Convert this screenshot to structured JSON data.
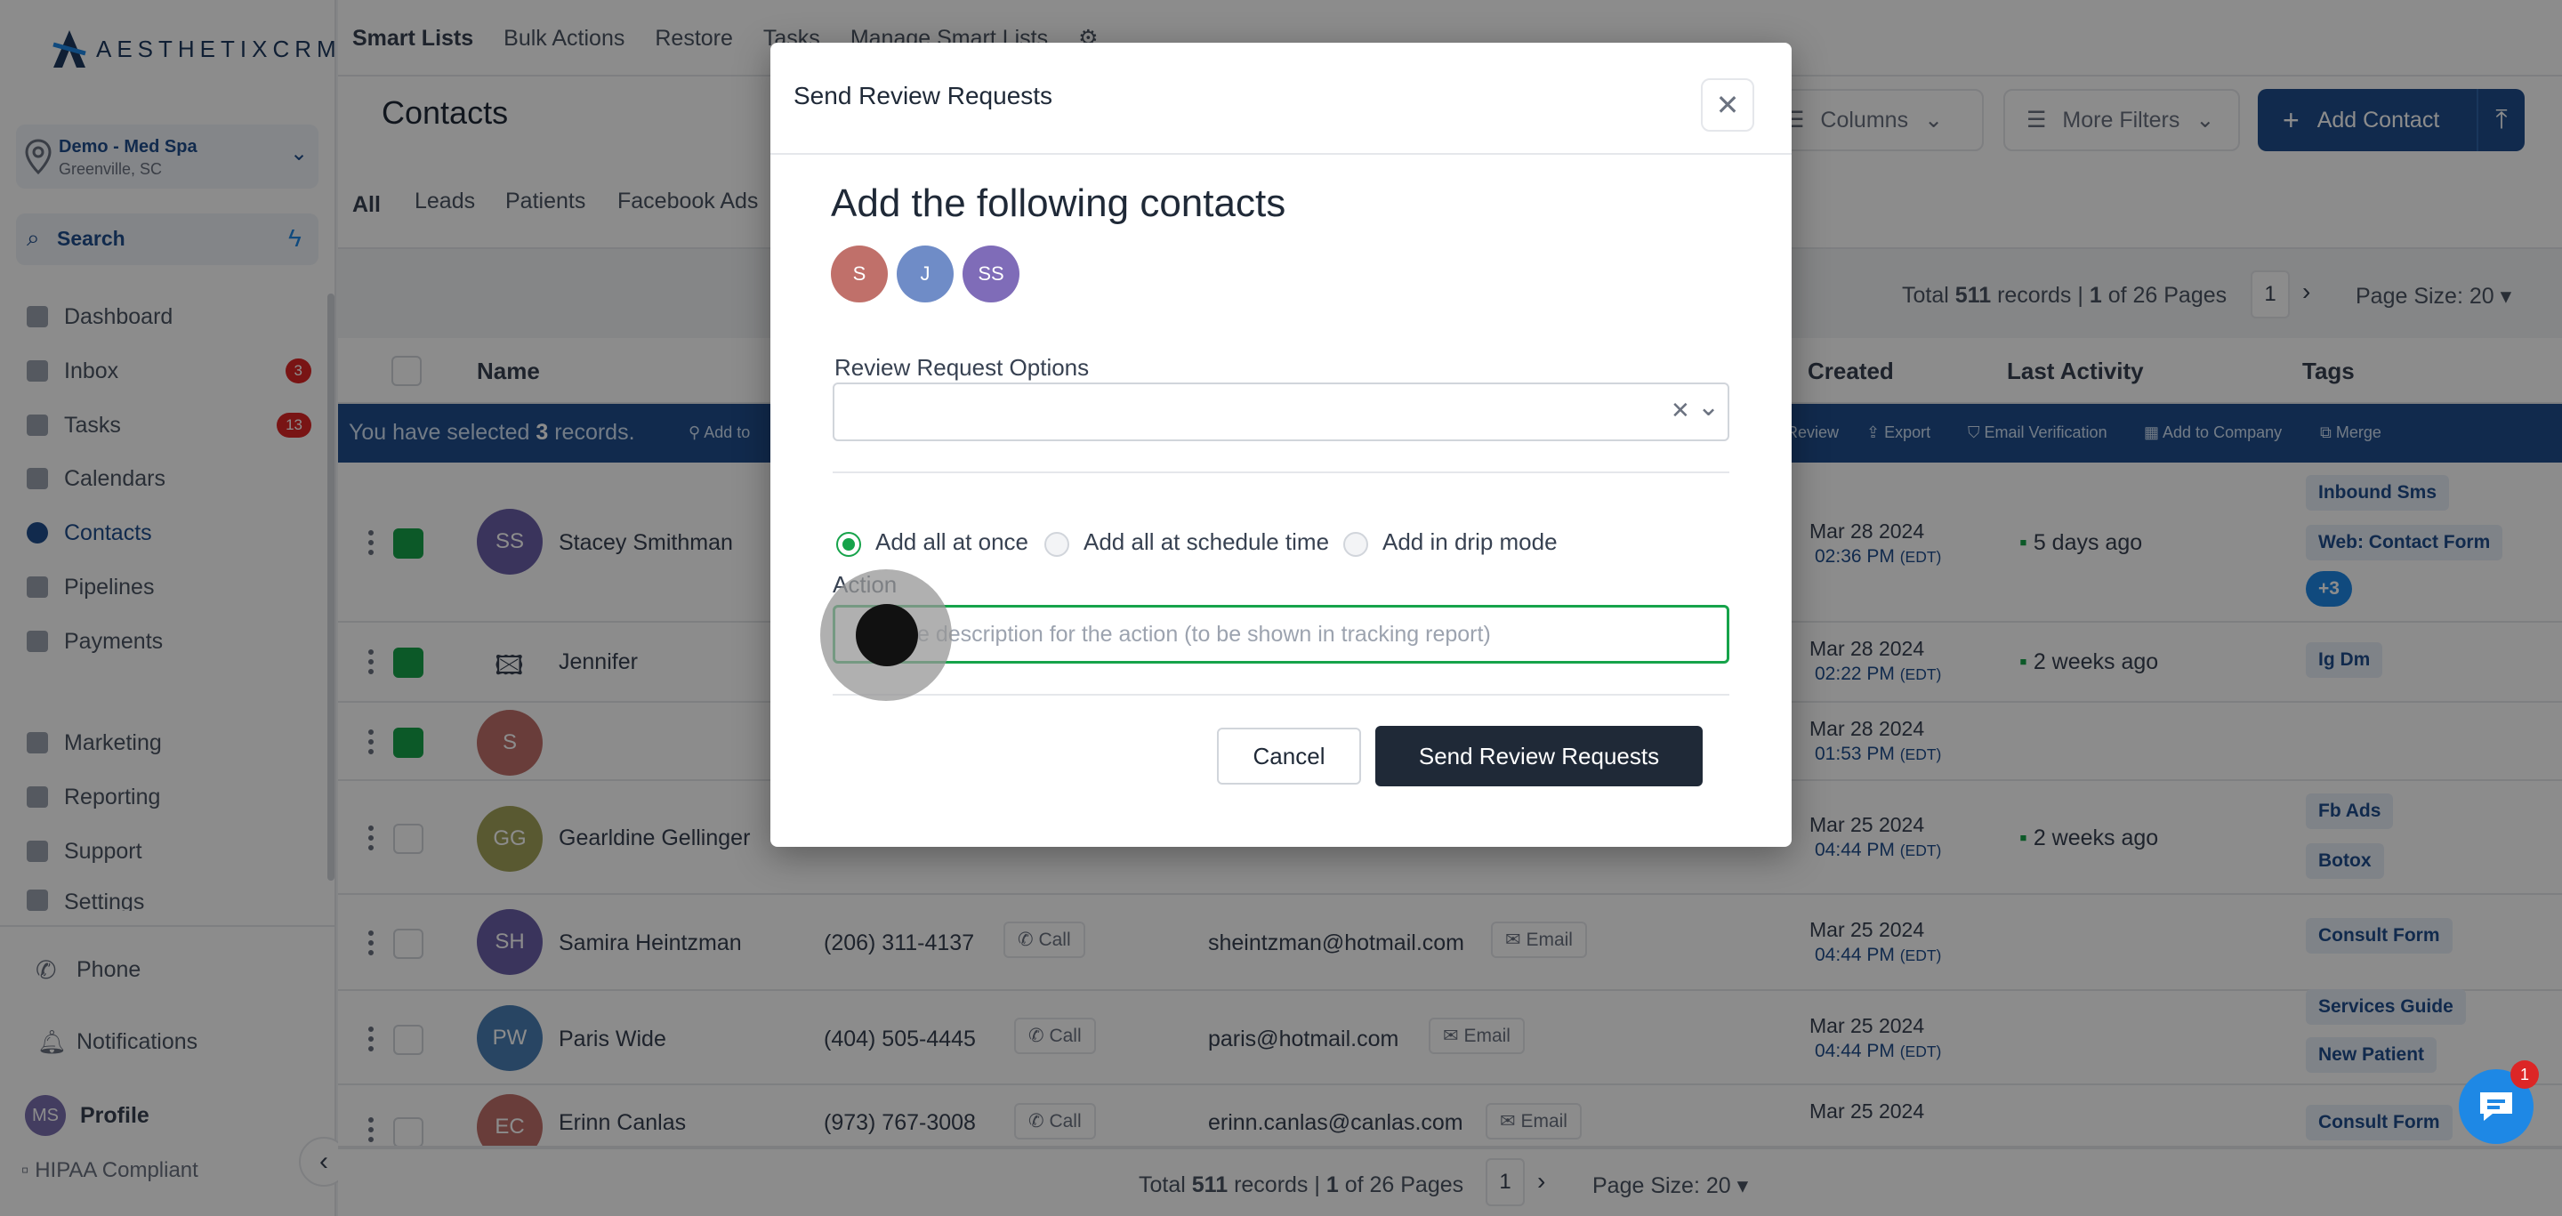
{
  "brand": {
    "logo_text": "AESTHETIXCRM"
  },
  "location": {
    "name": "Demo - Med Spa",
    "city": "Greenville, SC"
  },
  "sidebar": {
    "search_label": "Search",
    "items": [
      {
        "label": "Dashboard"
      },
      {
        "label": "Inbox",
        "badge": "3"
      },
      {
        "label": "Tasks",
        "badge": "13"
      },
      {
        "label": "Calendars"
      },
      {
        "label": "Contacts"
      },
      {
        "label": "Pipelines"
      },
      {
        "label": "Payments"
      },
      {
        "label": "Marketing"
      },
      {
        "label": "Reporting"
      },
      {
        "label": "Support"
      },
      {
        "label": "Settings"
      }
    ],
    "phone": "Phone",
    "notifications": "Notifications",
    "profile_initials": "MS",
    "profile": "Profile",
    "hipaa": "HIPAA Compliant"
  },
  "topnav": [
    "Smart Lists",
    "Bulk Actions",
    "Restore",
    "Tasks",
    "Manage Smart Lists"
  ],
  "header": {
    "title": "Contacts",
    "columns": "Columns",
    "more_filters": "More Filters",
    "add_contact": "Add Contact"
  },
  "tabs": [
    "All",
    "Leads",
    "Patients",
    "Facebook Ads"
  ],
  "pagination": {
    "total_prefix": "Total",
    "records": "511",
    "records_suffix": "records |",
    "page": "1",
    "of_pages": "of 26 Pages",
    "page_num": "1",
    "page_size": "Page Size: 20"
  },
  "table": {
    "headers": {
      "name": "Name",
      "created": "Created",
      "last_activity": "Last Activity",
      "tags": "Tags"
    },
    "selection": {
      "prefix": "You have selected",
      "count": "3",
      "suffix": "records.",
      "add_to": "Add to",
      "review": "Review",
      "export": "Export",
      "email_verification": "Email Verification",
      "add_to_company": "Add to Company",
      "merge": "Merge"
    },
    "rows": [
      {
        "initials": "SS",
        "name": "Stacey Smithman",
        "date": "Mar 28 2024",
        "time": "02:36 PM",
        "tz": "(EDT)",
        "activity": "5 days ago",
        "tags": [
          "Inbound Sms",
          "Web: Contact Form",
          "+3"
        ]
      },
      {
        "initials": "",
        "name": "Jennifer",
        "date": "Mar 28 2024",
        "time": "02:22 PM",
        "tz": "(EDT)",
        "activity": "2 weeks ago",
        "tags": [
          "Ig Dm"
        ]
      },
      {
        "initials": "S",
        "name": "",
        "date": "Mar 28 2024",
        "time": "01:53 PM",
        "tz": "(EDT)",
        "activity": "",
        "tags": []
      },
      {
        "initials": "GG",
        "name": "Gearldine Gellinger",
        "date": "Mar 25 2024",
        "time": "04:44 PM",
        "tz": "(EDT)",
        "activity": "2 weeks ago",
        "tags": [
          "Fb Ads",
          "Botox"
        ]
      },
      {
        "initials": "SH",
        "name": "Samira Heintzman",
        "phone": "(206) 311-4137",
        "call": "Call",
        "email": "sheintzman@hotmail.com",
        "email_btn": "Email",
        "date": "Mar 25 2024",
        "time": "04:44 PM",
        "tz": "(EDT)",
        "tags": [
          "Consult Form"
        ]
      },
      {
        "initials": "PW",
        "name": "Paris Wide",
        "phone": "(404) 505-4445",
        "call": "Call",
        "email": "paris@hotmail.com",
        "email_btn": "Email",
        "date": "Mar 25 2024",
        "time": "04:44 PM",
        "tz": "(EDT)",
        "tags": [
          "Services Guide",
          "New Patient"
        ]
      },
      {
        "initials": "EC",
        "name": "Erinn Canlas",
        "phone": "(973) 767-3008",
        "call": "Call",
        "email": "erinn.canlas@canlas.com",
        "email_btn": "Email",
        "date": "Mar 25 2024",
        "tags": [
          "Consult Form"
        ]
      }
    ]
  },
  "modal": {
    "title": "Send Review Requests",
    "heading": "Add the following contacts",
    "avatars": [
      {
        "initials": "S",
        "color": "#c0706a"
      },
      {
        "initials": "J",
        "color": "#6f8cc7"
      },
      {
        "initials": "SS",
        "color": "#7f6cb8"
      }
    ],
    "options_label": "Review Request Options",
    "radio": [
      "Add all at once",
      "Add all at schedule time",
      "Add in drip mode"
    ],
    "action_label": "Action",
    "action_placeholder": "Enter description for the action (to be shown in tracking report)",
    "action_visible": "e description for the action (to be shown in tracking report)",
    "cancel": "Cancel",
    "send": "Send Review Requests"
  },
  "chat_badge": "1",
  "colors": {
    "primary": "#1f4e8c",
    "success": "#16a34a",
    "danger": "#dc2626"
  }
}
